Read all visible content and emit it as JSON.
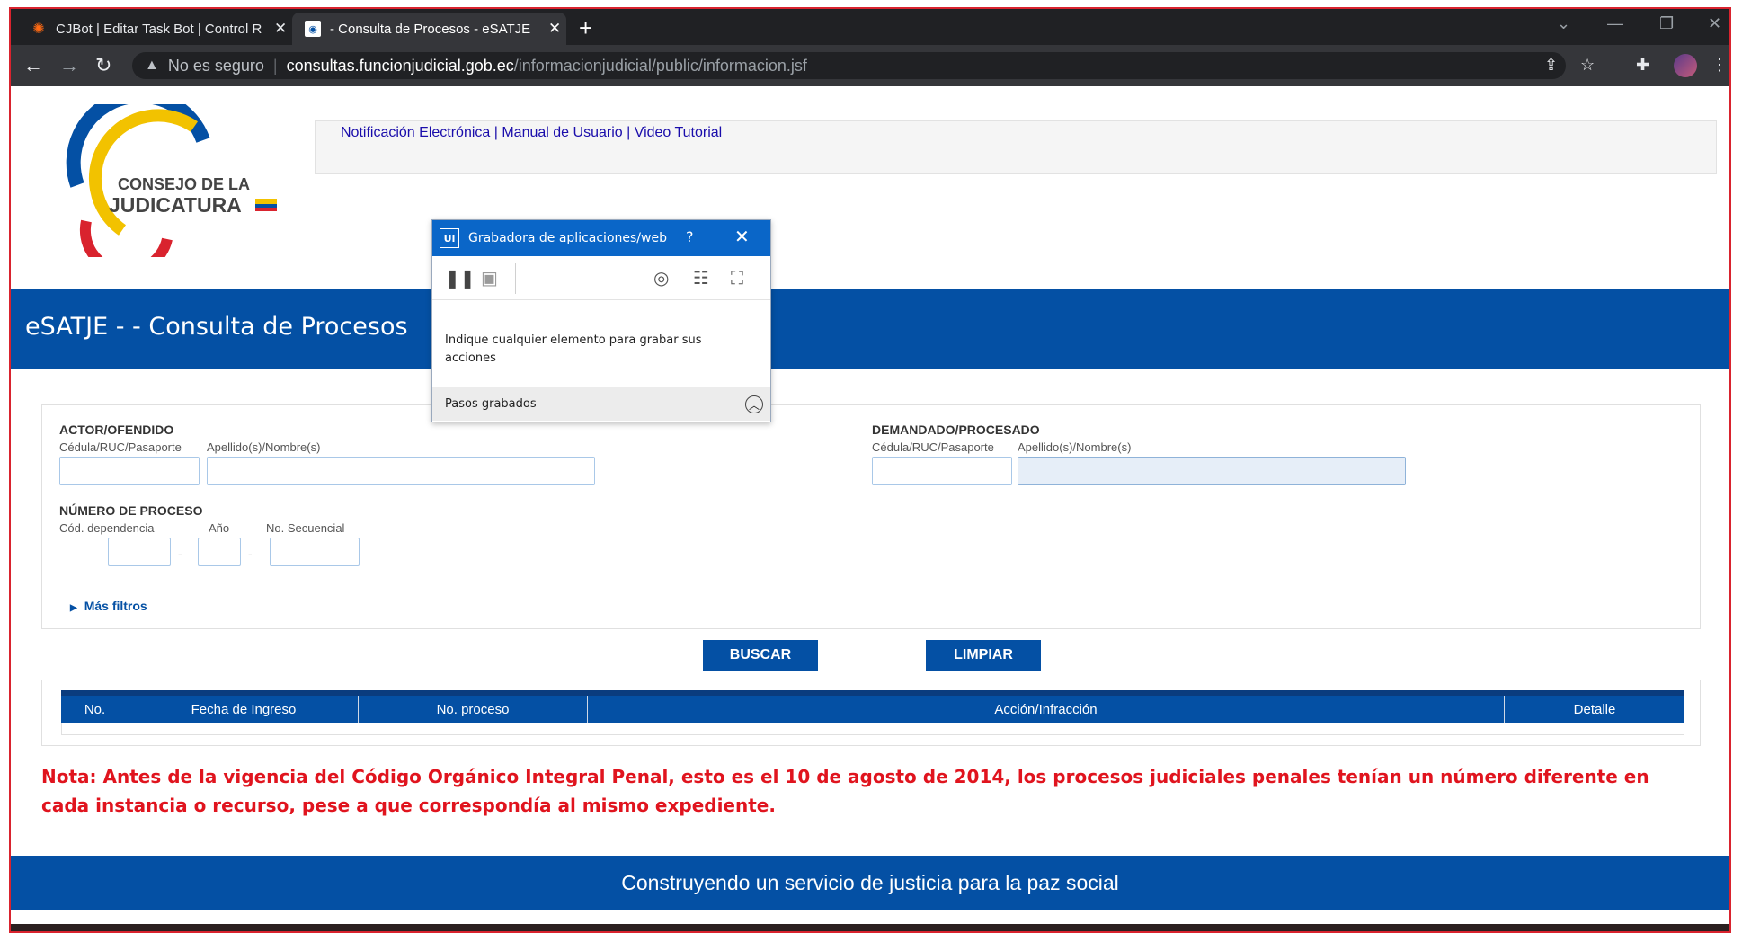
{
  "browser": {
    "tabs": [
      {
        "title": "CJBot | Editar Task Bot | Control R",
        "active": false
      },
      {
        "title": "- Consulta de Procesos - eSATJE",
        "active": true
      }
    ],
    "security_label": "No es seguro",
    "url_host": "consultas.funcionjudicial.gob.ec",
    "url_path": "/informacionjudicial/public/informacion.jsf"
  },
  "page": {
    "logo_line1": "CONSEJO DE LA",
    "logo_line2": "JUDICATURA",
    "top_links": "Notificación Electrónica | Manual de Usuario | Video Tutorial",
    "header_title": "eSATJE - - Consulta de Procesos",
    "actor": {
      "section": "ACTOR/OFENDIDO",
      "label_id": "Cédula/RUC/Pasaporte",
      "label_name": "Apellido(s)/Nombre(s)"
    },
    "demandado": {
      "section": "DEMANDADO/PROCESADO",
      "label_id": "Cédula/RUC/Pasaporte",
      "label_name": "Apellido(s)/Nombre(s)"
    },
    "numero": {
      "section": "NÚMERO DE PROCESO",
      "label_dep": "Cód. dependencia",
      "label_anio": "Año",
      "label_seq": "No. Secuencial",
      "sep": "-"
    },
    "mas_filtros": "Más filtros",
    "buttons": {
      "buscar": "BUSCAR",
      "limpiar": "LIMPIAR"
    },
    "table_headers": [
      "No.",
      "Fecha de Ingreso",
      "No. proceso",
      "Acción/Infracción",
      "Detalle"
    ],
    "nota": "Nota: Antes de la vigencia del Código Orgánico Integral Penal, esto es el 10 de agosto de 2014, los procesos judiciales penales tenían un número diferente en cada instancia o recurso, pese a que correspondía al mismo expediente.",
    "footer": "Construyendo un servicio de justicia para la paz social"
  },
  "recorder": {
    "icon_label": "Ui",
    "title": "Grabadora de aplicaciones/web",
    "help": "?",
    "message": "Indique cualquier elemento para grabar sus acciones",
    "steps_label": "Pasos grabados"
  },
  "colors": {
    "brand_blue": "#0450a4",
    "note_red": "#e0141e",
    "recorder_blue": "#0a66c8"
  }
}
